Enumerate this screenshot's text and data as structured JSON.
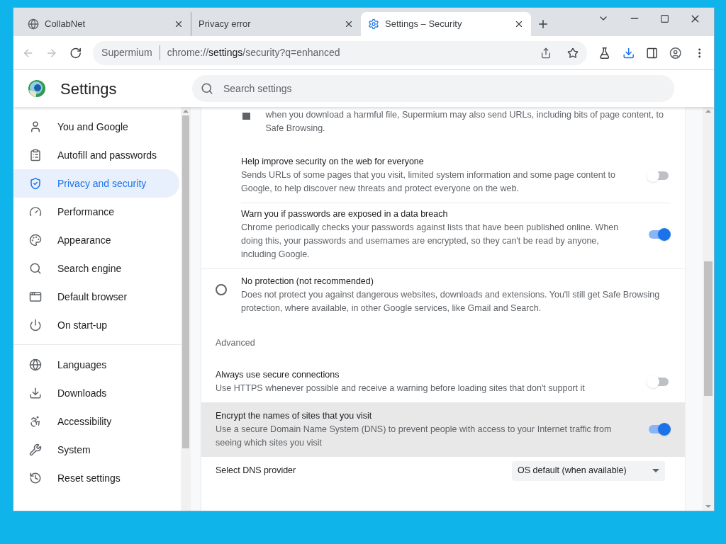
{
  "tabs": [
    {
      "title": "CollabNet",
      "selected": false
    },
    {
      "title": "Privacy error",
      "selected": false
    },
    {
      "title": "Settings – Security",
      "selected": true
    }
  ],
  "toolbar": {
    "site": "Supermium",
    "url_host": "chrome://",
    "url_page": "settings",
    "url_rest": "/security?q=enhanced"
  },
  "header": {
    "title": "Settings",
    "search_placeholder": "Search settings"
  },
  "sidebar": {
    "groups": [
      [
        {
          "label": "You and Google",
          "selected": false
        },
        {
          "label": "Autofill and passwords",
          "selected": false
        },
        {
          "label": "Privacy and security",
          "selected": true
        },
        {
          "label": "Performance",
          "selected": false
        },
        {
          "label": "Appearance",
          "selected": false
        },
        {
          "label": "Search engine",
          "selected": false
        },
        {
          "label": "Default browser",
          "selected": false
        },
        {
          "label": "On start-up",
          "selected": false
        }
      ],
      [
        {
          "label": "Languages",
          "selected": false
        },
        {
          "label": "Downloads",
          "selected": false
        },
        {
          "label": "Accessibility",
          "selected": false
        },
        {
          "label": "System",
          "selected": false
        },
        {
          "label": "Reset settings",
          "selected": false
        }
      ]
    ]
  },
  "content": {
    "top_text": "when you download a harmful file, Supermium may also send URLs, including bits of page content, to Safe Browsing.",
    "sub_settings": [
      {
        "title": "Help improve security on the web for everyone",
        "description": "Sends URLs of some pages that you visit, limited system information and some page content to Google, to help discover new threats and protect everyone on the web.",
        "on": false
      },
      {
        "title": "Warn you if passwords are exposed in a data breach",
        "description": "Chrome periodically checks your passwords against lists that have been published online. When doing this, your passwords and usernames are encrypted, so they can't be read by anyone, including Google.",
        "on": true
      }
    ],
    "radio": {
      "title": "No protection (not recommended)",
      "description": "Does not protect you against dangerous websites, downloads and extensions. You'll still get Safe Browsing protection, where available, in other Google services, like Gmail and Search.",
      "selected": false
    },
    "section": "Advanced",
    "settings": [
      {
        "title": "Always use secure connections",
        "description": "Use HTTPS whenever possible and receive a warning before loading sites that don't support it",
        "on": false,
        "highlighted": false
      },
      {
        "title": "Encrypt the names of sites that you visit",
        "description": "Use a secure Domain Name System (DNS) to prevent people with access to your Internet traffic from seeing which sites you visit",
        "on": true,
        "highlighted": true
      }
    ],
    "dns": {
      "label": "Select DNS provider",
      "value": "OS default (when available)"
    }
  }
}
